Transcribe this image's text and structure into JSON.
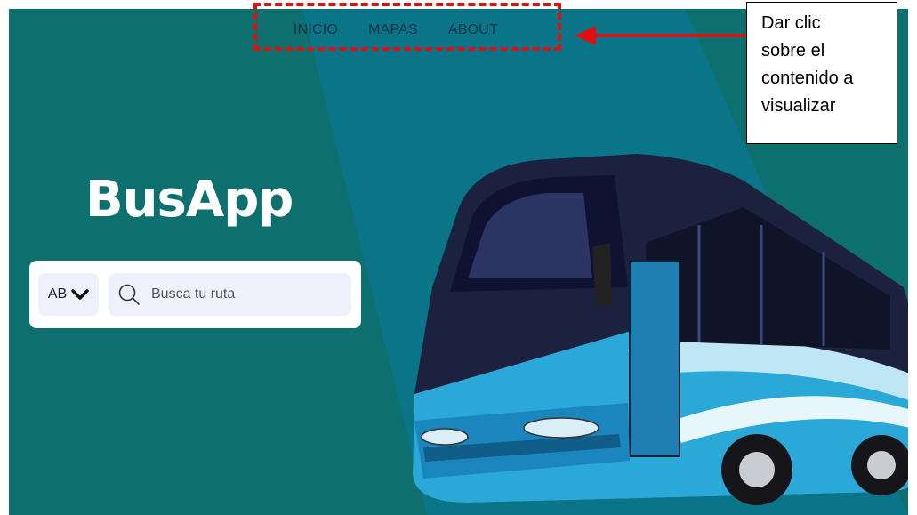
{
  "nav": {
    "items": [
      {
        "label": "INICIO"
      },
      {
        "label": "MAPAS"
      },
      {
        "label": "ABOUT"
      }
    ]
  },
  "callout": {
    "text": "Dar clic\nsobre el\ncontenido a\nvisualizar"
  },
  "brand": {
    "title": "BusApp"
  },
  "search": {
    "lang_value": "AB",
    "placeholder": "Busca tu ruta"
  },
  "colors": {
    "background": "#0e6f6f",
    "beam": "#0a7588",
    "annotation_red": "#e01010",
    "text_dark": "#10304a",
    "field_bg": "#eef0fc",
    "bus_blue": "#2aa8d8"
  },
  "icons": {
    "dropdown": "chevron-down-icon",
    "search": "search-icon",
    "arrow": "arrow-left-icon"
  }
}
